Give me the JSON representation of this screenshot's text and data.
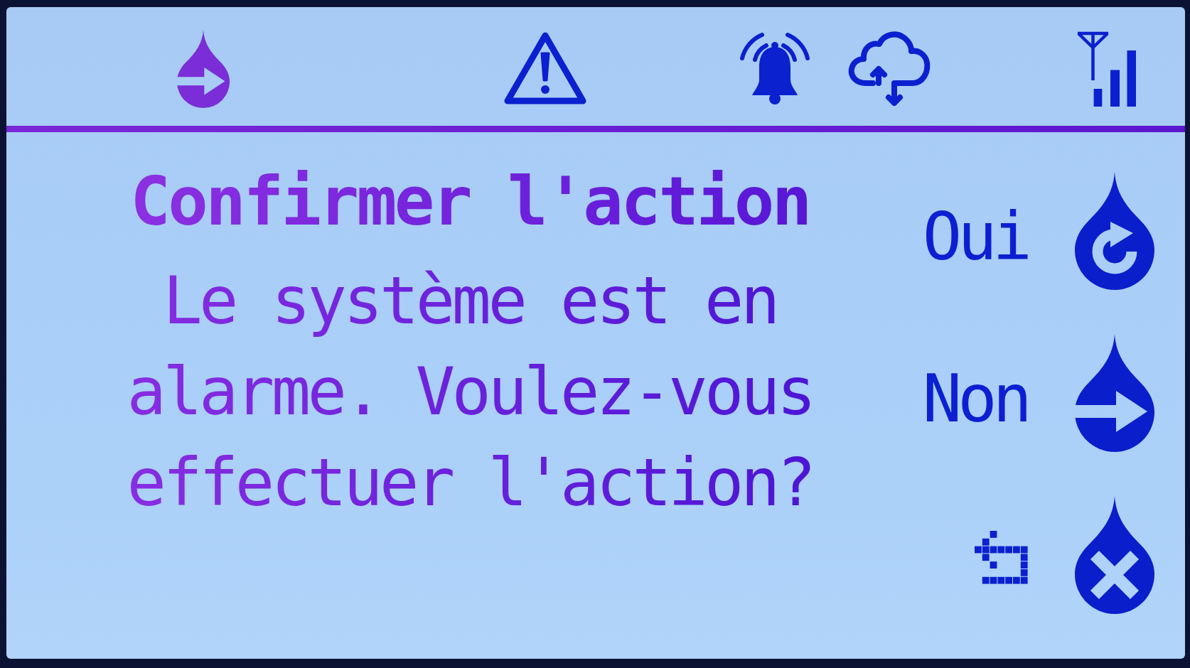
{
  "dialog": {
    "title": "Confirmer l'action",
    "message": "Le système est en alarme. Voulez-vous effectuer l'action?"
  },
  "options": [
    {
      "kind": "confirm",
      "label": "Oui"
    },
    {
      "kind": "skip",
      "label": "Non"
    },
    {
      "kind": "cancel"
    }
  ]
}
